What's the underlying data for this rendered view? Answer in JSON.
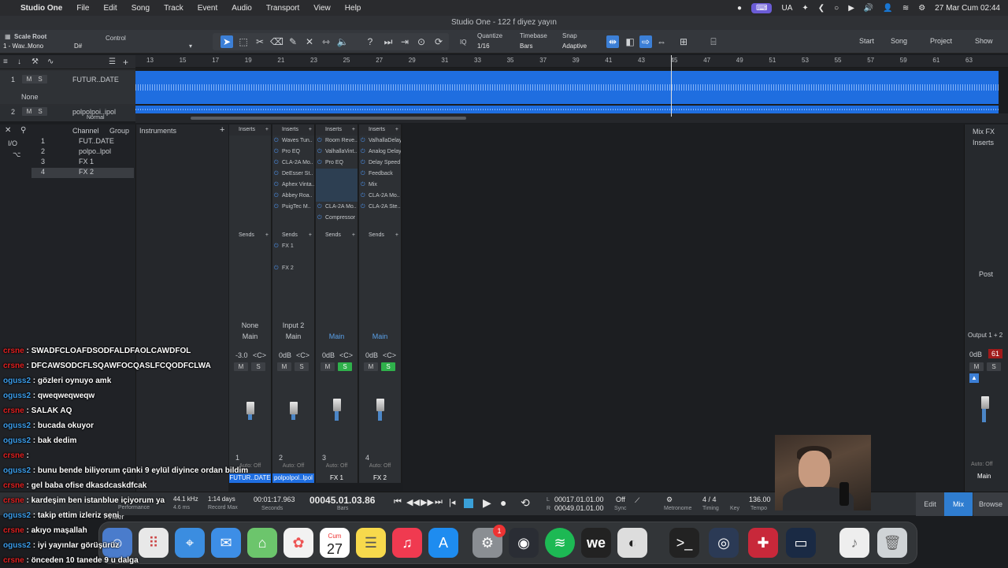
{
  "menubar": {
    "app_name": "Studio One",
    "items": [
      "File",
      "Edit",
      "Song",
      "Track",
      "Event",
      "Audio",
      "Transport",
      "View",
      "Help"
    ],
    "lang": "UA",
    "datetime": "27 Mar Cum  02:44"
  },
  "window": {
    "title": "Studio One - 122 f diyez yayın"
  },
  "toolbar": {
    "scale_root": "Scale Root",
    "scale_value": "1 - Wav..Mono",
    "key": "D#",
    "control_label": "Control",
    "iq": "IQ",
    "quantize_label": "Quantize",
    "quantize_value": "1/16",
    "timebase_label": "Timebase",
    "timebase_value": "Bars",
    "snap_label": "Snap",
    "snap_value": "Adaptive",
    "nav": [
      "Start",
      "Song",
      "Project",
      "Show"
    ]
  },
  "ruler": {
    "ticks": [
      "13",
      "15",
      "17",
      "19",
      "21",
      "23",
      "25",
      "27",
      "29",
      "31",
      "33",
      "35",
      "37",
      "39",
      "41",
      "43",
      "45",
      "47",
      "49",
      "51",
      "53",
      "55",
      "57",
      "59",
      "61",
      "63"
    ]
  },
  "tracks": [
    {
      "num": "1",
      "name": "FUTUR..DATE",
      "input": "None"
    },
    {
      "num": "2",
      "name": "polpolpoi..ipol",
      "mode": "Normal"
    }
  ],
  "channel_list": {
    "headers": [
      "Channel",
      "Group",
      "Instruments"
    ],
    "io": "I/O",
    "rows": [
      {
        "num": "1",
        "name": "FUT..DATE"
      },
      {
        "num": "2",
        "name": "polpo..lpol"
      },
      {
        "num": "3",
        "name": "FX 1"
      },
      {
        "num": "4",
        "name": "FX 2"
      }
    ]
  },
  "strips": [
    {
      "inserts": [],
      "sends": [],
      "input": "None",
      "output": "Main",
      "volume": "-3.0",
      "pan": "<C>",
      "num": "1",
      "name": "FUTUR..DATE",
      "name_color": "#1f6ee0",
      "solo_on": false
    },
    {
      "inserts": [
        "Waves Tun..",
        "Pro EQ",
        "CLA-2A Mo..",
        "DeEsser St..",
        "Aphex Vinta..",
        "Abbey Roa..",
        "PuigTec M.."
      ],
      "sends": [
        "FX 1",
        "FX 2"
      ],
      "input": "Input 2",
      "output": "Main",
      "volume": "0dB",
      "pan": "<C>",
      "num": "2",
      "name": "polpolpol..lpol",
      "name_color": "#1f6ee0",
      "solo_on": false
    },
    {
      "inserts": [
        "Room Reve..",
        "ValhallaVint..",
        "Pro EQ",
        "",
        "",
        "",
        "CLA-2A Mo..",
        "Compressor"
      ],
      "sends": [],
      "input": "",
      "output": "Main",
      "volume": "0dB",
      "pan": "<C>",
      "num": "3",
      "name": "FX 1",
      "name_color": "#2d3034",
      "solo_on": true
    },
    {
      "inserts": [
        "ValhallaDelay",
        "Analog Delay",
        "Delay Speed",
        "Feedback",
        "Mix",
        "CLA-2A Mo..",
        "CLA-2A Ste.."
      ],
      "sends": [],
      "input": "",
      "output": "Main",
      "volume": "0dB",
      "pan": "<C>",
      "num": "4",
      "name": "FX 2",
      "name_color": "#2d3034",
      "solo_on": true
    }
  ],
  "mixer_labels": {
    "inserts": "Inserts",
    "sends": "Sends",
    "auto_off": "Auto: Off",
    "mix_fx": "Mix FX",
    "post": "Post"
  },
  "main_strip": {
    "output": "Output 1 + 2",
    "volume": "0dB",
    "peak": "61",
    "name": "Main"
  },
  "transport": {
    "sample_rate": "44.1 kHz",
    "latency": "4.6 ms",
    "performance": "Performance",
    "record_max": "1:14 days",
    "record_max_label": "Record Max",
    "seconds": "00:01:17.963",
    "seconds_label": "Seconds",
    "bars": "00045.01.03.86",
    "bars_label": "Bars",
    "loop_l": "00017.01.01.00",
    "loop_r": "00049.01.01.00",
    "sync": "Off",
    "sync_label": "Sync",
    "metronome_label": "Metronome",
    "timing": "4 / 4",
    "timing_label": "Timing",
    "key_label": "Key",
    "tempo": "136.00",
    "tempo_label": "Tempo",
    "modes": [
      "Edit",
      "Mix",
      "Browse"
    ]
  },
  "chat": [
    {
      "user": "crsne",
      "color": "red",
      "msg": "SWADFCLOAFDSODFALDFAOLCAWDFOL"
    },
    {
      "user": "crsne",
      "color": "red",
      "msg": "DFCAWSODCFLSQAWFOCQASLFCQODFCLWA"
    },
    {
      "user": "oguss2",
      "color": "blue",
      "msg": "gözleri oynuyo amk"
    },
    {
      "user": "oguss2",
      "color": "blue",
      "msg": "qweqweqweqw"
    },
    {
      "user": "crsne",
      "color": "red",
      "msg": "SALAK AQ"
    },
    {
      "user": "oguss2",
      "color": "blue",
      "msg": "bucada okuyor"
    },
    {
      "user": "oguss2",
      "color": "blue",
      "msg": "bak dedim"
    },
    {
      "user": "crsne",
      "color": "red",
      "msg": ""
    },
    {
      "user": "oguss2",
      "color": "blue",
      "msg": "bunu bende biliyorum çünki 9 eylül diyince ordan bildim"
    },
    {
      "user": "crsne",
      "color": "red",
      "msg": "gel baba ofise dkasdcaskdfcak"
    },
    {
      "user": "crsne",
      "color": "red",
      "msg": "kardeşim ben istanblue içiyorum ya"
    },
    {
      "user": "oguss2",
      "color": "blue",
      "msg": "takip ettim izleriz seni"
    },
    {
      "user": "crsne",
      "color": "red",
      "msg": "akıyo maşallah"
    },
    {
      "user": "oguss2",
      "color": "blue",
      "msg": "iyi yayınlar görüşürüz"
    },
    {
      "user": "crsne",
      "color": "red",
      "msg": "önceden 10 tanede 9 u dalga"
    }
  ],
  "dock": {
    "finder_label": "Finder",
    "calendar_month": "Cum",
    "calendar_day": "27",
    "badge": "1",
    "icons": [
      "finder-icon",
      "launchpad-icon",
      "safari-icon",
      "mail-icon",
      "maps-icon",
      "photos-icon",
      "calendar-icon",
      "notes-icon",
      "music-icon",
      "appstore-icon",
      "settings-icon",
      "studio-one-icon",
      "spotify-icon",
      "we-icon",
      "waves-icon",
      "terminal-icon",
      "obs-icon",
      "app-icon",
      "screen-icon",
      "file-icon",
      "trash-icon"
    ]
  },
  "colors": {
    "accent": "#3c7fd6",
    "solo": "#2fb14b",
    "chat_red": "#e02020",
    "chat_blue": "#3a9be8"
  }
}
